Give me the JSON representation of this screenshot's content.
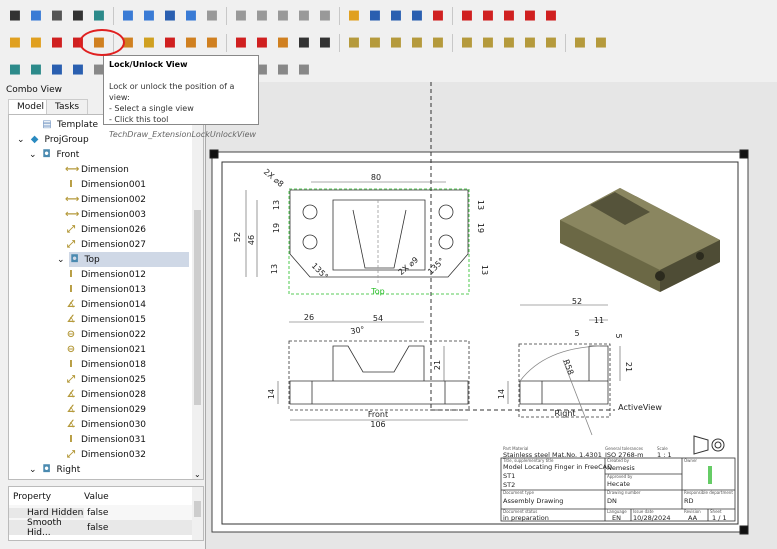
{
  "toolbar": {
    "row1": [
      [
        "whats-this-icon",
        "#333"
      ],
      [
        "box-zoom-icon",
        "#3a7bd5"
      ],
      [
        "zoom-icon",
        "#555"
      ],
      [
        "draw-style-icon",
        "#333"
      ],
      [
        "std-views-icon",
        "#2c8a8a"
      ],
      [
        "back-icon",
        "#3a7bd5"
      ],
      [
        "forward-icon",
        "#3a7bd5"
      ],
      [
        "macro-icon",
        "#2a5fb0"
      ],
      [
        "zoom-in-icon",
        "#3a7bd5"
      ],
      [
        "view-fit-icon",
        "#999"
      ],
      [
        "view-front-icon",
        "#999"
      ],
      [
        "view-top-icon",
        "#999"
      ],
      [
        "view-right-icon",
        "#999"
      ],
      [
        "view-rear-icon",
        "#999"
      ],
      [
        "measure-icon",
        "#999"
      ],
      [
        "part-icon",
        "#e0a020"
      ],
      [
        "folder-icon",
        "#2a5fb0"
      ],
      [
        "link-icon",
        "#2a5fb0"
      ],
      [
        "link-import-icon",
        "#2a5fb0"
      ],
      [
        "dim-chain-h-icon",
        "#d02020"
      ],
      [
        "dim-chain-v-icon",
        "#d02020"
      ],
      [
        "dim-chain-oblique-icon",
        "#d02020"
      ],
      [
        "dim-cascade-icon",
        "#d02020"
      ],
      [
        "dim-angle-icon",
        "#d02020"
      ],
      [
        "dim-arc-icon",
        "#d02020"
      ]
    ],
    "row2": [
      [
        "page-icon",
        "#e0a020"
      ],
      [
        "page-template-icon",
        "#e0a020"
      ],
      [
        "position-section-icon",
        "#d02020"
      ],
      [
        "lock-unlock-view-icon",
        "#d02020"
      ],
      [
        "align-icon",
        "#d08020"
      ],
      [
        "hole-table-icon",
        "#d08020"
      ],
      [
        "symbol-icon",
        "#d0a020"
      ],
      [
        "weld-icon",
        "#d02020"
      ],
      [
        "cosmetic-vertex-icon",
        "#d08020"
      ],
      [
        "midpoint-icon",
        "#d08020"
      ],
      [
        "centerline-icon",
        "#d02020"
      ],
      [
        "circle-centerline-icon",
        "#d02020"
      ],
      [
        "line-icon",
        "#d08020"
      ],
      [
        "export-svg-icon",
        "#333"
      ],
      [
        "export-dxf-icon",
        "#333"
      ],
      [
        "dim-length-icon",
        "#b59a3c"
      ],
      [
        "dim-horizontal-icon",
        "#b59a3c"
      ],
      [
        "dim-vertical-icon",
        "#b59a3c"
      ],
      [
        "dim-radius-icon",
        "#b59a3c"
      ],
      [
        "dim-diameter-icon",
        "#b59a3c"
      ],
      [
        "dim-angle3pt-icon",
        "#b59a3c"
      ],
      [
        "dim-angle-dim-icon",
        "#b59a3c"
      ],
      [
        "dim-extent-icon",
        "#b59a3c"
      ],
      [
        "balloon-icon",
        "#b59a3c"
      ],
      [
        "leader-icon",
        "#b59a3c"
      ],
      [
        "richtext-icon",
        "#b59a3c"
      ],
      [
        "arc-length-icon",
        "#b59a3c"
      ]
    ],
    "row3": [
      [
        "view-icon",
        "#2c8a8a"
      ],
      [
        "active-view-icon",
        "#2c8a8a"
      ],
      [
        "projgroup-icon",
        "#2a5fb0"
      ],
      [
        "section-icon",
        "#2a5fb0"
      ],
      [
        "hatch-icon",
        "#888"
      ],
      [
        "geom-hatch-icon",
        "#c8b020"
      ],
      [
        "image-icon",
        "#2a8a2a"
      ],
      [
        "balloon-leader-icon",
        "#2a5fb0"
      ],
      [
        "toggle-frame-icon",
        "#d02020"
      ],
      [
        "annotation-icon",
        "#e0a020"
      ],
      [
        "arch-view-icon",
        "#e08020"
      ],
      [
        "clip-group-icon",
        "#888"
      ],
      [
        "spreadsheet-view-icon",
        "#888"
      ],
      [
        "symbol-insert-icon",
        "#888"
      ]
    ]
  },
  "tooltip": {
    "title": "Lock/Unlock View",
    "line1": "Lock or unlock the position of a view:",
    "line2": "- Select a single view",
    "line3": "- Click this tool",
    "command": "TechDraw_ExtensionLockUnlockView"
  },
  "combo": {
    "title": "Combo View",
    "tabs": [
      "Model",
      "Tasks"
    ]
  },
  "tree": [
    {
      "label": "Template",
      "icon": "template-icon",
      "glyph": "▤",
      "depth": 2,
      "color": "#6a8fbf"
    },
    {
      "label": "ProjGroup",
      "icon": "projgroup-icon",
      "glyph": "◆",
      "depth": 1,
      "color": "#2a8ac0",
      "expanded": true
    },
    {
      "label": "Front",
      "icon": "view-icon",
      "glyph": "◘",
      "depth": 2,
      "color": "#4a8ab0",
      "expanded": true
    },
    {
      "label": "Dimension",
      "icon": "dim-horizontal-icon",
      "glyph": "⟷",
      "depth": 3,
      "color": "#b59a3c"
    },
    {
      "label": "Dimension001",
      "icon": "dim-vertical-icon",
      "glyph": "I",
      "depth": 3,
      "color": "#b59a3c"
    },
    {
      "label": "Dimension002",
      "icon": "dim-horizontal-icon",
      "glyph": "⟷",
      "depth": 3,
      "color": "#b59a3c"
    },
    {
      "label": "Dimension003",
      "icon": "dim-horizontal-icon",
      "glyph": "⟷",
      "depth": 3,
      "color": "#b59a3c"
    },
    {
      "label": "Dimension026",
      "icon": "dim-length-icon",
      "glyph": "⤢",
      "depth": 3,
      "color": "#b59a3c"
    },
    {
      "label": "Dimension027",
      "icon": "dim-length-icon",
      "glyph": "⤢",
      "depth": 3,
      "color": "#b59a3c"
    },
    {
      "label": "Top",
      "icon": "view-icon",
      "glyph": "◘",
      "depth": 2,
      "color": "#4a8ab0",
      "expanded": true,
      "selected": true
    },
    {
      "label": "Dimension012",
      "icon": "dim-vertical-icon",
      "glyph": "I",
      "depth": 3,
      "color": "#b59a3c"
    },
    {
      "label": "Dimension013",
      "icon": "dim-vertical-icon",
      "glyph": "I",
      "depth": 3,
      "color": "#b59a3c"
    },
    {
      "label": "Dimension014",
      "icon": "dim-angle-icon",
      "glyph": "∡",
      "depth": 3,
      "color": "#b59a3c"
    },
    {
      "label": "Dimension015",
      "icon": "dim-angle-icon",
      "glyph": "∡",
      "depth": 3,
      "color": "#b59a3c"
    },
    {
      "label": "Dimension022",
      "icon": "dim-diameter-icon",
      "glyph": "⊖",
      "depth": 3,
      "color": "#b59a3c"
    },
    {
      "label": "Dimension021",
      "icon": "dim-diameter-icon",
      "glyph": "⊖",
      "depth": 3,
      "color": "#b59a3c"
    },
    {
      "label": "Dimension018",
      "icon": "dim-vertical-icon",
      "glyph": "I",
      "depth": 3,
      "color": "#b59a3c"
    },
    {
      "label": "Dimension025",
      "icon": "dim-length-icon",
      "glyph": "⤢",
      "depth": 3,
      "color": "#b59a3c"
    },
    {
      "label": "Dimension028",
      "icon": "dim-angle-icon",
      "glyph": "∡",
      "depth": 3,
      "color": "#b59a3c"
    },
    {
      "label": "Dimension029",
      "icon": "dim-angle-icon",
      "glyph": "∡",
      "depth": 3,
      "color": "#b59a3c"
    },
    {
      "label": "Dimension030",
      "icon": "dim-angle-icon",
      "glyph": "∡",
      "depth": 3,
      "color": "#b59a3c"
    },
    {
      "label": "Dimension031",
      "icon": "dim-vertical-icon",
      "glyph": "I",
      "depth": 3,
      "color": "#b59a3c"
    },
    {
      "label": "Dimension032",
      "icon": "dim-length-icon",
      "glyph": "⤢",
      "depth": 3,
      "color": "#b59a3c"
    },
    {
      "label": "Right",
      "icon": "view-icon",
      "glyph": "◘",
      "depth": 2,
      "color": "#4a8ab0",
      "expanded": true
    }
  ],
  "properties": {
    "headers": [
      "Property",
      "Value"
    ],
    "rows": [
      [
        "Hard Hidden",
        "false"
      ],
      [
        "Smooth Hid...",
        "false"
      ]
    ]
  },
  "drawing": {
    "views": {
      "top": "Top",
      "front": "Front",
      "right": "Right",
      "active": "ActiveView"
    },
    "dims": {
      "d80": "80",
      "d52v": "52",
      "d46": "46",
      "d13a": "13",
      "d19a": "19",
      "d13b": "13",
      "d13c": "13",
      "d19b": "19",
      "d13d": "13",
      "phi8": "2X ⌀8",
      "phi9": "2X ⌀9",
      "a135a": "135°",
      "a135b": "135°",
      "d26": "26",
      "d54": "54",
      "a30": "30°",
      "d21a": "21",
      "d14a": "14",
      "d106": "106",
      "d52": "52",
      "d11": "11",
      "d5a": "5",
      "d5b": "5",
      "d21b": "21",
      "d14b": "14",
      "r58": "R58"
    },
    "title_block": {
      "material_label": "Part Material",
      "material": "Stainless steel Mat.No. 1.4301",
      "tol_label": "General tolerances",
      "tol": "ISO 2768-m",
      "scale_label": "Scale",
      "scale": "1 : 1",
      "title_label": "Title, supplementary title",
      "title": "Model Locating Finger in FreeCAD",
      "st1": "ST1",
      "st2": "ST2",
      "created_label": "Created by",
      "created": "Nemesis",
      "approved_label": "Approved by",
      "approved": "Hecate",
      "owner_label": "Owner",
      "doctype_label": "Document type",
      "doctype": "Assembly Drawing",
      "drawnum_label": "Drawing number",
      "drawnum": "DN",
      "dept_label": "Responsible department",
      "dept": "RD",
      "status_label": "Document status",
      "status": "in preparation",
      "lang_label": "Language",
      "lang": "EN",
      "date_label": "Issue date",
      "date": "10/28/2024",
      "rev_label": "Revision",
      "rev": "AA",
      "sheet_label": "Sheet",
      "sheet": "1 / 1"
    },
    "colors": {
      "selection": "#22bb22",
      "model": "#6b6845",
      "highlight": "#e02020"
    }
  }
}
